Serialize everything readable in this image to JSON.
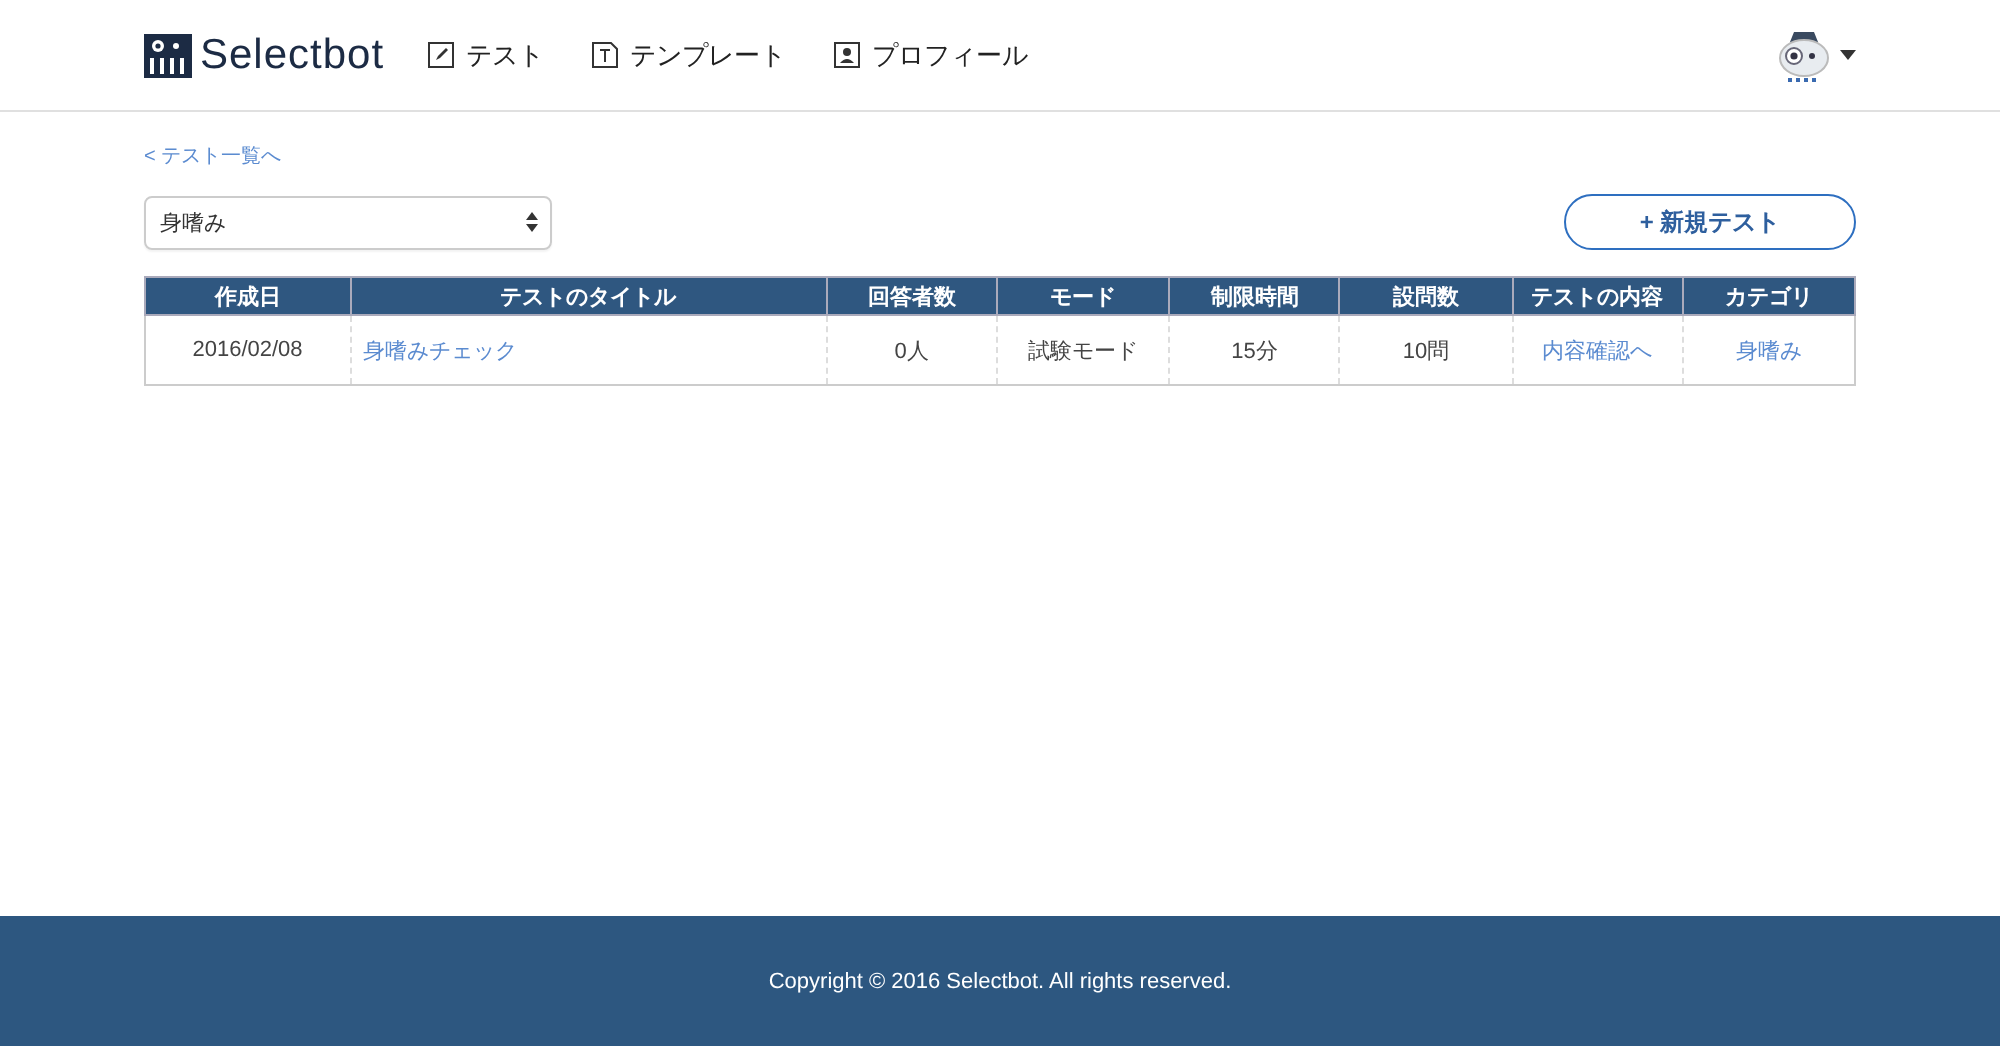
{
  "header": {
    "logo": "Selectbot",
    "nav": [
      {
        "label": "テスト"
      },
      {
        "label": "テンプレート"
      },
      {
        "label": "プロフィール"
      }
    ]
  },
  "back_link": "< テスト一覧へ",
  "category_select": {
    "value": "身嗜み"
  },
  "new_button": "+ 新規テスト",
  "table": {
    "columns": [
      "作成日",
      "テストのタイトル",
      "回答者数",
      "モード",
      "制限時間",
      "設問数",
      "テストの内容",
      "カテゴリ"
    ],
    "rows": [
      {
        "cells": [
          {
            "kind": "text",
            "text": "2016/02/08"
          },
          {
            "kind": "link",
            "text": "身嗜みチェック"
          },
          {
            "kind": "text",
            "text": "0人"
          },
          {
            "kind": "text",
            "text": "試験モード"
          },
          {
            "kind": "text",
            "text": "15分"
          },
          {
            "kind": "text",
            "text": "10問"
          },
          {
            "kind": "link",
            "text": "内容確認へ"
          },
          {
            "kind": "link",
            "text": "身嗜み"
          }
        ]
      }
    ]
  },
  "footer": "Copyright © 2016 Selectbot. All rights reserved."
}
